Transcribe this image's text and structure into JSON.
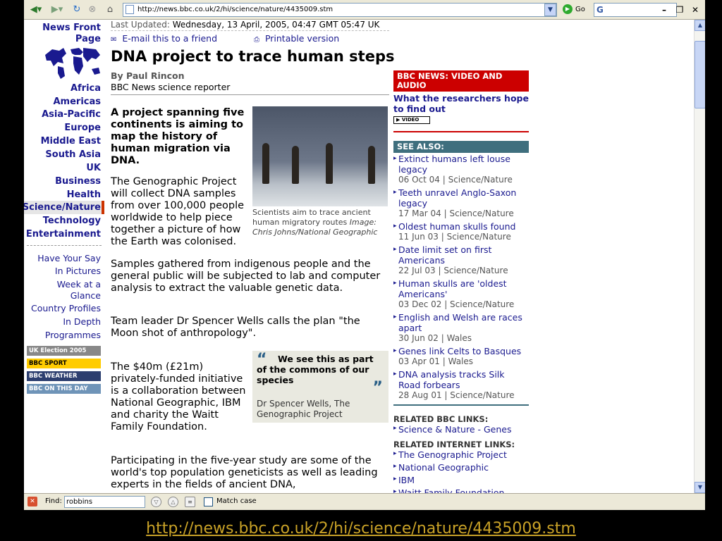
{
  "browser": {
    "url": "http://news.bbc.co.uk/2/hi/science/nature/4435009.stm",
    "go_label": "Go",
    "google_label": "G"
  },
  "sidebar": {
    "front_page": "News Front Page",
    "items": [
      "Africa",
      "Americas",
      "Asia-Pacific",
      "Europe",
      "Middle East",
      "South Asia",
      "UK",
      "Business",
      "Health",
      "Science/Nature",
      "Technology",
      "Entertainment"
    ],
    "active": "Science/Nature",
    "links": [
      "Have Your Say",
      "In Pictures",
      "Week at a Glance",
      "Country Profiles",
      "In Depth",
      "Programmes"
    ],
    "logos": [
      "UK Election 2005",
      "BBC SPORT",
      "BBC WEATHER",
      "BBC ON THIS DAY"
    ]
  },
  "article": {
    "last_updated_label": "Last Updated:",
    "last_updated_value": "Wednesday, 13 April, 2005, 04:47 GMT 05:47 UK",
    "email_link": "E-mail this to a friend",
    "print_link": "Printable version",
    "headline": "DNA project to trace human steps",
    "byline": "By Paul Rincon",
    "role": "BBC News science reporter",
    "lead": "A project spanning five continents is aiming to map the history of human migration via DNA.",
    "para1": "The Genographic Project will collect DNA samples from over 100,000 people worldwide to help piece together a picture of how the Earth was colonised.",
    "caption": "Scientists aim to trace ancient human migratory routes",
    "caption_credit": "Image: Chris Johns/National Geographic",
    "para2": "Samples gathered from indigenous people and the general public will be subjected to lab and computer analysis to extract the valuable genetic data.",
    "para3": "Team leader Dr Spencer Wells calls the plan \"the Moon shot of anthropology\".",
    "para4": "The $40m (£21m) privately-funded initiative is a collaboration between National Geographic, IBM and charity the Waitt Family Foundation.",
    "para5": "Participating in the five-year study are some of the world's top population geneticists as well as leading experts in the fields of ancient DNA,",
    "quote_open": "“",
    "quote_close": "”",
    "quote": "We see this as part of the commons of our species",
    "quote_source": "Dr Spencer Wells, The Genographic Project"
  },
  "right": {
    "video_header": "BBC NEWS: VIDEO AND AUDIO",
    "video_link": "What the researchers hope to find out",
    "video_button": "▶ VIDEO",
    "see_also": "SEE ALSO:",
    "see_also_items": [
      {
        "title": "Extinct humans left louse legacy",
        "date": "06 Oct 04 |  Science/Nature"
      },
      {
        "title": "Teeth unravel Anglo-Saxon legacy",
        "date": "17 Mar 04 |  Science/Nature"
      },
      {
        "title": "Oldest human skulls found",
        "date": "11 Jun 03 |  Science/Nature"
      },
      {
        "title": "Date limit set on first Americans",
        "date": "22 Jul 03 |  Science/Nature"
      },
      {
        "title": "Human skulls are 'oldest Americans'",
        "date": "03 Dec 02 |  Science/Nature"
      },
      {
        "title": "English and Welsh are races apart",
        "date": "30 Jun 02 |  Wales"
      },
      {
        "title": "Genes link Celts to Basques",
        "date": "03 Apr 01 |  Wales"
      },
      {
        "title": "DNA analysis tracks Silk Road forbears",
        "date": "28 Aug 01 |  Science/Nature"
      }
    ],
    "related_bbc": "RELATED BBC LINKS:",
    "related_bbc_links": [
      "Science & Nature - Genes"
    ],
    "related_internet": "RELATED INTERNET LINKS:",
    "related_internet_links": [
      "The Genographic Project",
      "National Geographic",
      "IBM",
      "Waitt Family Foundation"
    ]
  },
  "findbar": {
    "label": "Find:",
    "value": "robbins",
    "match_case": "Match case"
  },
  "footer_url": "http://news.bbc.co.uk/2/hi/science/nature/4435009.stm"
}
